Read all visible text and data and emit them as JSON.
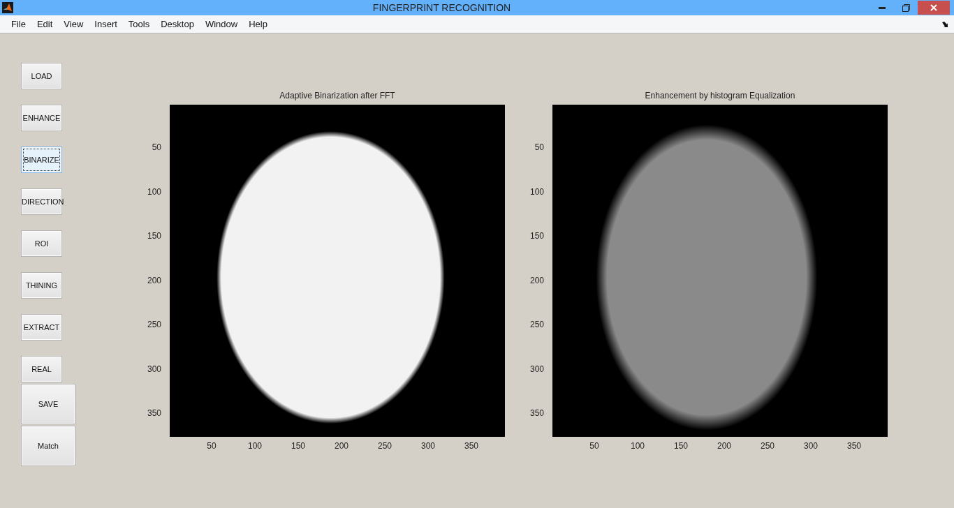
{
  "window": {
    "title": "FINGERPRINT RECOGNITION"
  },
  "menu": [
    "File",
    "Edit",
    "View",
    "Insert",
    "Tools",
    "Desktop",
    "Window",
    "Help"
  ],
  "buttons": [
    {
      "label": "LOAD",
      "focused": false,
      "kind": "small"
    },
    {
      "label": "ENHANCE",
      "focused": false,
      "kind": "small"
    },
    {
      "label": "BINARIZE",
      "focused": true,
      "kind": "small"
    },
    {
      "label": "DIRECTION",
      "focused": false,
      "kind": "small"
    },
    {
      "label": "ROI",
      "focused": false,
      "kind": "small"
    },
    {
      "label": "THINING",
      "focused": false,
      "kind": "small"
    },
    {
      "label": "EXTRACT",
      "focused": false,
      "kind": "small"
    },
    {
      "label": "REAL",
      "focused": false,
      "kind": "small"
    },
    {
      "label": "SAVE",
      "focused": false,
      "kind": "large"
    },
    {
      "label": "Match",
      "focused": false,
      "kind": "large"
    }
  ],
  "axes": [
    {
      "title": "Adaptive Binarization after FFT",
      "kind": "binarized",
      "xticks": [
        "50",
        "100",
        "150",
        "200",
        "250",
        "300",
        "350"
      ],
      "yticks": [
        "50",
        "100",
        "150",
        "200",
        "250",
        "300",
        "350"
      ]
    },
    {
      "title": "Enhancement by histogram Equalization",
      "kind": "enhanced",
      "xticks": [
        "50",
        "100",
        "150",
        "200",
        "250",
        "300",
        "350"
      ],
      "yticks": [
        "50",
        "100",
        "150",
        "200",
        "250",
        "300",
        "350"
      ]
    }
  ]
}
